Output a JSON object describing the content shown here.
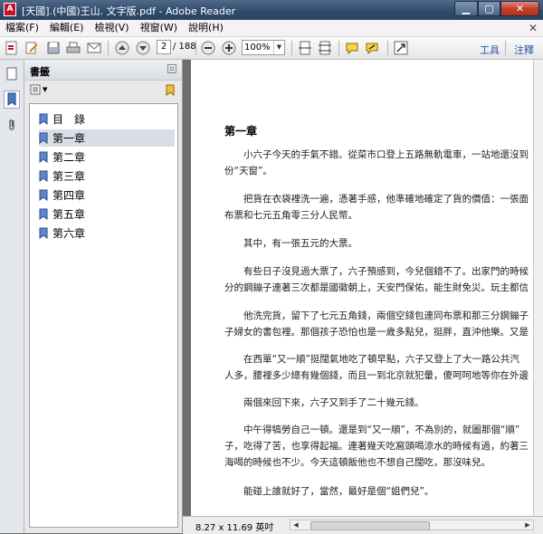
{
  "window": {
    "title": "[天國].(中國)王山. 文字版.pdf - Adobe Reader",
    "app_icon": "acrobat-icon"
  },
  "menu": [
    "檔案(F)",
    "編輯(E)",
    "檢視(V)",
    "視窗(W)",
    "說明(H)"
  ],
  "toolbar": {
    "page_current": "2",
    "page_total": "/ 188",
    "zoom": "100%",
    "tools_label": "工具",
    "comment_label": "注釋"
  },
  "bookmarks_panel": {
    "title": "書籤",
    "items": [
      {
        "label": "目　錄"
      },
      {
        "label": "第一章"
      },
      {
        "label": "第二章"
      },
      {
        "label": "第三章"
      },
      {
        "label": "第四章"
      },
      {
        "label": "第五章"
      },
      {
        "label": "第六章"
      }
    ],
    "selected_index": 1
  },
  "document": {
    "chapter_title": "第一章",
    "paragraphs": [
      [
        "小六子今天的手氣不錯。從菜市口登上五路無軌電車，一站地還沒到",
        "份“天窗”。"
      ],
      [
        "把貨在衣袋裡洗一遍，憑著手感，他準確地確定了貨的價值：一張面",
        "布票和七元五角零三分人民幣。"
      ],
      [
        "其中，有一張五元的大票。"
      ],
      [
        "有些日子沒見過大票了，六子預感到，今兒個錯不了。出家門的時候",
        "分的鋼鏰子連著三次都是國徽朝上，天安門保佑，能生財免災。玩主都信"
      ],
      [
        "他洗完貨，留下了七元五角錢，兩個空錢包連同布票和那三分鋼鏰子",
        "子婦女的書包裡。那個孩子恐怕也是一歲多點兒，挺胖，直沖他樂。又是"
      ],
      [
        "在西單“又一順”挺闊氣地吃了頓早點，六子又登上了大一路公共汽",
        "人多，腰裡多少總有幾個錢，而且一到北京就犯暈，傻呵呵地等你在外邊"
      ],
      [
        "兩個來回下來，六子又到手了二十幾元錢。"
      ],
      [
        "中午得犒勞自己一頓。還是到“又一順”，不為別的，就圖那個“順”",
        "子，吃得了苦，也享得起福。連著幾天吃窩頭喝涼水的時候有過，約著三",
        "海喝的時候也不少。今天這頓飯他也不想自己闊吃，那沒味兒。"
      ],
      [
        "能碰上誰就好了，當然，最好是個“姐們兒”。"
      ]
    ]
  },
  "status": {
    "page_size": "8.27 x 11.69 英吋"
  }
}
